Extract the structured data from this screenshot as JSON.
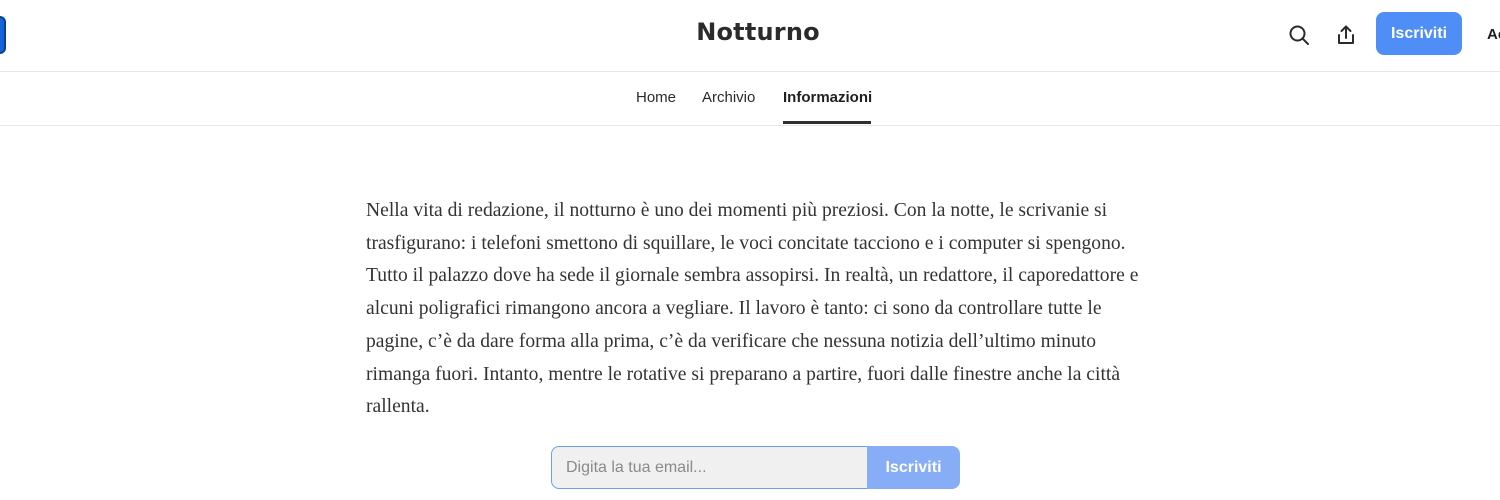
{
  "header": {
    "site_title": "Notturno",
    "subscribe_label": "Iscriviti",
    "account_label": "Ac",
    "icons": {
      "search": "search-icon",
      "share": "share-icon"
    },
    "accent_color": "#4f8ef7"
  },
  "nav": {
    "items": [
      {
        "label": "Home",
        "active": false
      },
      {
        "label": "Archivio",
        "active": false
      },
      {
        "label": "Informazioni",
        "active": true
      }
    ]
  },
  "main": {
    "intro_text": "Nella vita di redazione, il notturno è uno dei momenti più preziosi. Con la notte, le scrivanie si trasfigurano: i telefoni smettono di squillare, le voci concitate tacciono e i computer si spengono. Tutto il palazzo dove ha sede il giornale sembra assopirsi. In realtà, un redattore, il caporedattore e alcuni poligrafici rimangono ancora a vegliare. Il lavoro è tanto: ci sono da controllare tutte le pagine, c’è da dare forma alla prima, c’è da verificare che nessuna notizia dell’ultimo minuto rimanga fuori. Intanto, mentre le rotative si preparano a partire, fuori dalle finestre anche la città rallenta.",
    "subscribe_form": {
      "email_placeholder": "Digita la tua email...",
      "email_value": "",
      "button_label": "Iscriviti"
    }
  }
}
